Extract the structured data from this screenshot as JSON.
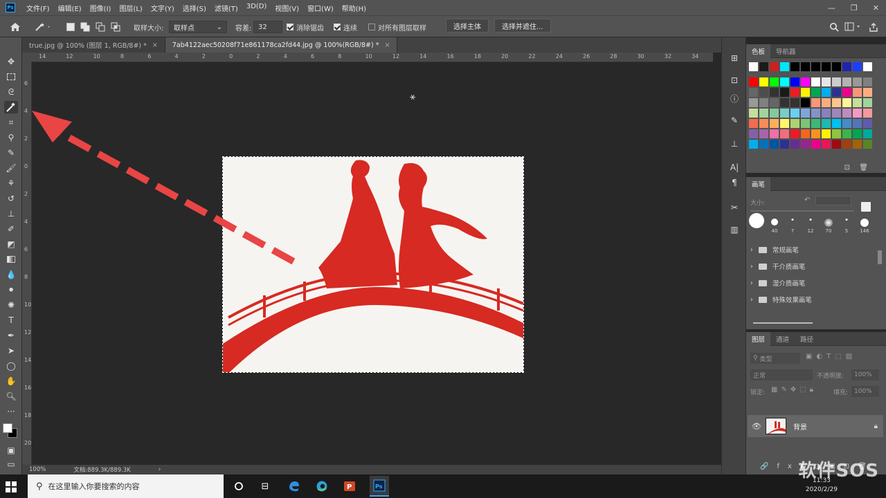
{
  "app": {
    "logo_text": "Ps",
    "menu": [
      "文件(F)",
      "编辑(E)",
      "图像(I)",
      "图层(L)",
      "文字(Y)",
      "选择(S)",
      "滤镜(T)",
      "3D(D)",
      "视图(V)",
      "窗口(W)",
      "帮助(H)"
    ]
  },
  "options": {
    "sample_size_label": "取样大小:",
    "sample_size_value": "取样点",
    "tolerance_label": "容差:",
    "tolerance_value": "32",
    "antialias_label": "消除锯齿",
    "antialias_checked": true,
    "contiguous_label": "连续",
    "contiguous_checked": true,
    "sample_all_label": "对所有图层取样",
    "sample_all_checked": false,
    "select_subject_label": "选择主体",
    "select_mask_label": "选择并遮住..."
  },
  "tabs": [
    {
      "label": "true.jpg @ 100% (图层 1, RGB/8#) *",
      "active": false
    },
    {
      "label": "7ab4122aec50208f71e861178ca2fd44.jpg @ 100%(RGB/8#) *",
      "active": true
    }
  ],
  "ruler": {
    "h_ticks": [
      "14",
      "12",
      "10",
      "8",
      "6",
      "4",
      "2",
      "0",
      "2",
      "4",
      "6",
      "8",
      "10",
      "12",
      "14",
      "16",
      "18",
      "20",
      "22",
      "24",
      "26",
      "28",
      "30",
      "32",
      "34"
    ],
    "v_ticks": [
      "6",
      "4",
      "2",
      "0",
      "2",
      "4",
      "6",
      "8",
      "10",
      "12",
      "14",
      "16",
      "18",
      "20"
    ]
  },
  "status": {
    "zoom": "100%",
    "doc_info": "文档:889.3K/889.3K"
  },
  "swatches_panel": {
    "tab_swatches": "色板",
    "tab_navigator": "导航器",
    "recent_colors": [
      "#ffffff",
      "#1a1a1a",
      "#cc2020",
      "#00e5ff",
      "#000000",
      "#000000",
      "#000000",
      "#000000",
      "#000000",
      "#2222aa",
      "#1a40ff",
      "#ffffff"
    ],
    "colors": [
      "#ff0000",
      "#ffff00",
      "#00ff00",
      "#00ffff",
      "#0000ff",
      "#ff00ff",
      "#ffffff",
      "#e6e6e6",
      "#cccccc",
      "#b3b3b3",
      "#999999",
      "#808080",
      "#666666",
      "#4d4d4d",
      "#333333",
      "#1a1a1a",
      "#ed1c24",
      "#fff200",
      "#00a651",
      "#00aeef",
      "#2e3192",
      "#ec008c",
      "#f7977a",
      "#fbad82",
      "#999999",
      "#808080",
      "#666666",
      "#333333",
      "#333333",
      "#000000",
      "#f7977a",
      "#fbad82",
      "#fdc689",
      "#fff799",
      "#c4df9b",
      "#a3d39c",
      "#c4df9b",
      "#a3d39c",
      "#82ca9c",
      "#7accc8",
      "#6dcff6",
      "#7da7d9",
      "#8393ca",
      "#8781bd",
      "#a186be",
      "#bd8cbf",
      "#f49ac1",
      "#f5989d",
      "#f26c4f",
      "#f68e56",
      "#fbaf5d",
      "#fff568",
      "#acd373",
      "#7cc576",
      "#3bb878",
      "#1abbb4",
      "#00bff3",
      "#438ccb",
      "#5574b9",
      "#605ca8",
      "#8560a8",
      "#a864a8",
      "#f06eaa",
      "#f26d7d",
      "#ed1c24",
      "#f26522",
      "#f7941d",
      "#fff200",
      "#8dc63f",
      "#39b54a",
      "#00a651",
      "#00a99d",
      "#00aeef",
      "#0072bc",
      "#0054a6",
      "#2e3192",
      "#662d91",
      "#92278f",
      "#ec008c",
      "#ed145b",
      "#9e0b0f",
      "#a0410d",
      "#a36209",
      "#598527"
    ]
  },
  "brush_panel": {
    "title": "画笔",
    "size_label": "大小:",
    "presets": [
      "",
      "40",
      "7",
      "12",
      "70",
      "5",
      "146"
    ],
    "folders": [
      "常规画笔",
      "干介质画笔",
      "湿介质画笔",
      "特殊效果画笔"
    ]
  },
  "layers_panel": {
    "tab_layers": "图层",
    "tab_channels": "通道",
    "tab_paths": "路径",
    "filter_label": "类型",
    "blend_mode": "正常",
    "opacity_label": "不透明度:",
    "opacity_value": "100%",
    "lock_label": "锁定:",
    "fill_label": "填充:",
    "fill_value": "100%",
    "layer_name": "背景"
  },
  "taskbar": {
    "search_placeholder": "在这里输入你要搜索的内容",
    "time": "11:33",
    "date": "2020/2/29",
    "watermark": "软件SOS"
  }
}
